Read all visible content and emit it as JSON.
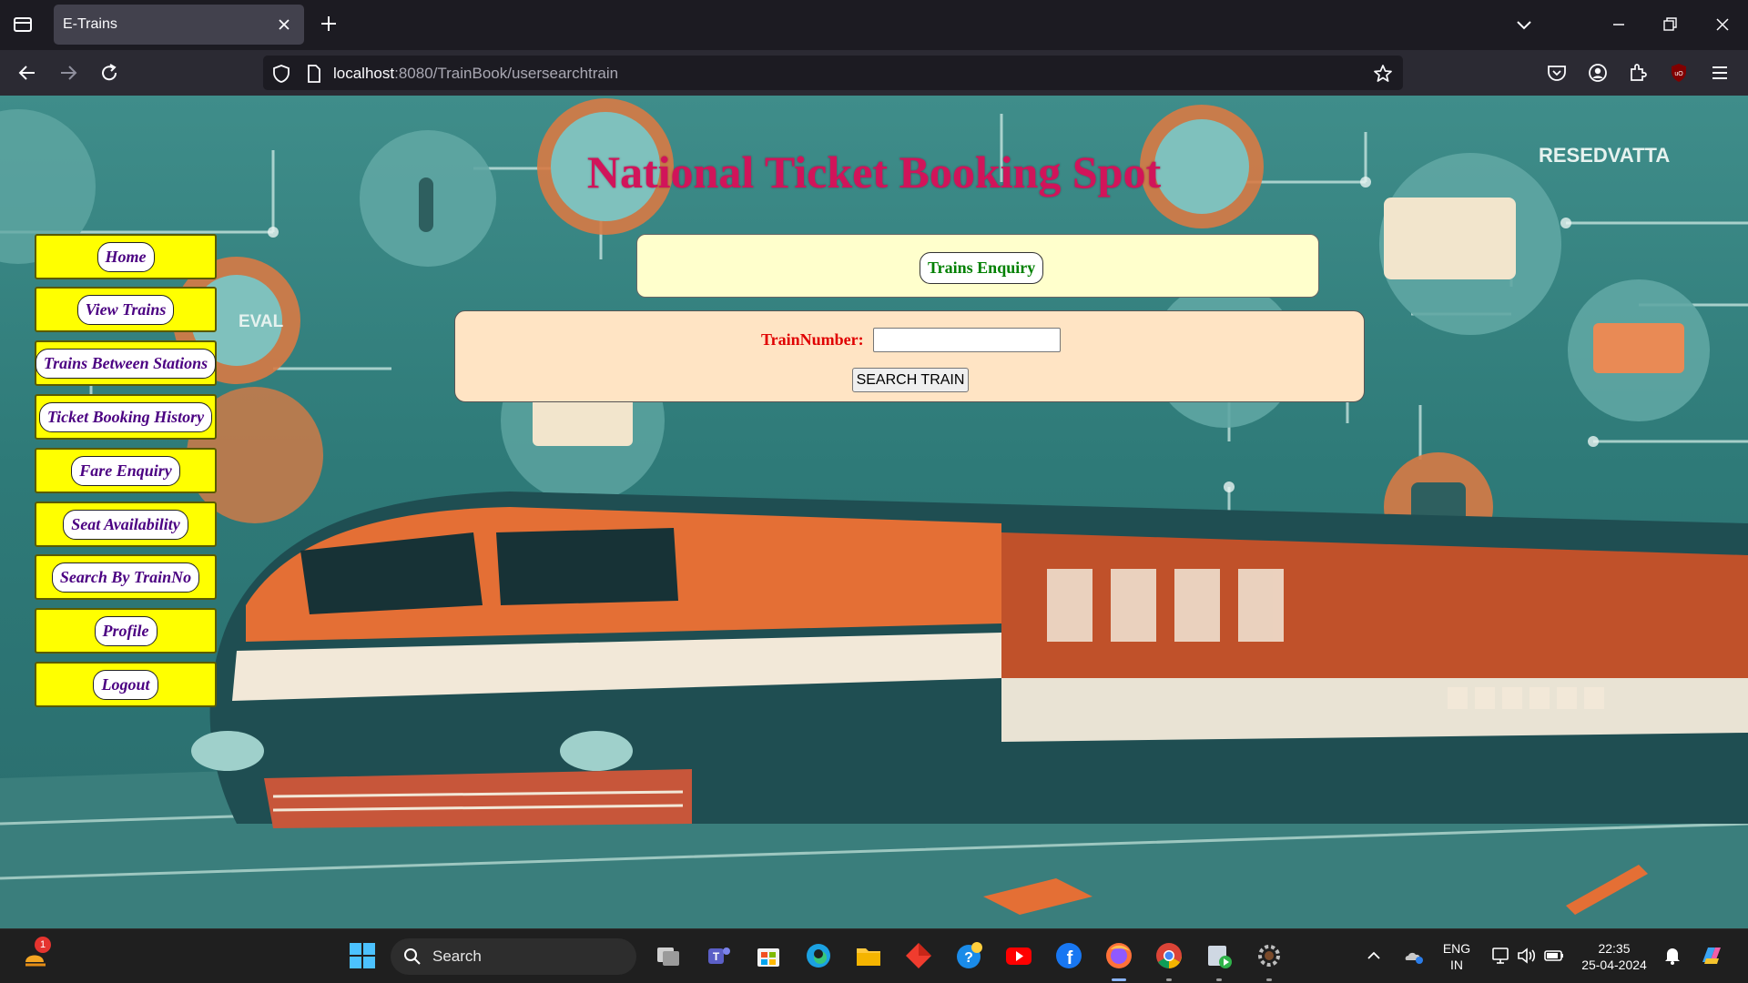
{
  "browser": {
    "tab_title": "E-Trains",
    "url_host": "localhost",
    "url_rest": ":8080/TrainBook/usersearchtrain"
  },
  "page": {
    "heading": "National Ticket Booking Spot",
    "menu": [
      {
        "label": "Home"
      },
      {
        "label": "View Trains"
      },
      {
        "label": "Trains Between Stations"
      },
      {
        "label": "Ticket Booking History"
      },
      {
        "label": "Fare Enquiry"
      },
      {
        "label": "Seat Availability"
      },
      {
        "label": "Search By TrainNo"
      },
      {
        "label": "Profile"
      },
      {
        "label": "Logout"
      }
    ],
    "enquiry_title": "Trains Enquiry",
    "search_form": {
      "label": "TrainNumber:",
      "input_value": "",
      "button_label": "SEARCH TRAIN"
    }
  },
  "background_art": {
    "sign_text": "RESEDVATTA",
    "left_sign_text": "EVAL"
  },
  "taskbar": {
    "search_label": "Search",
    "notification_badge": "1",
    "lang_line1": "ENG",
    "lang_line2": "IN",
    "time": "22:35",
    "date": "25-04-2024"
  },
  "colors": {
    "heading": "#d1145a",
    "menu_bg": "#ffff00",
    "menu_text": "#4b0082",
    "enquiry_bg": "#ffffcc",
    "enquiry_text": "#008000",
    "search_bg": "#ffe4c4",
    "label_red": "#e00000"
  }
}
